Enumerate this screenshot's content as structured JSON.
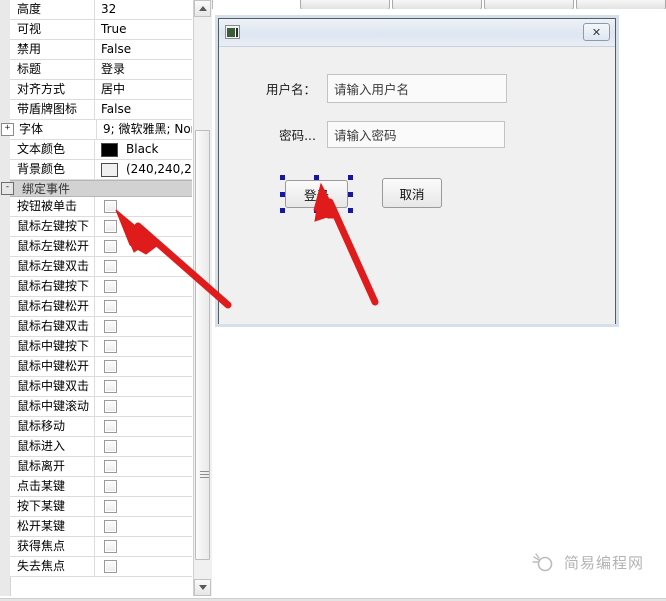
{
  "top_tabs": [
    {
      "label": ""
    },
    {
      "label": ""
    },
    {
      "label": ""
    },
    {
      "label": ""
    }
  ],
  "property_panel": {
    "properties": [
      {
        "name": "高度",
        "value": "32",
        "expander": "",
        "type": "text"
      },
      {
        "name": "可视",
        "value": "True",
        "expander": "",
        "type": "text"
      },
      {
        "name": "禁用",
        "value": "False",
        "expander": "",
        "type": "text"
      },
      {
        "name": "标题",
        "value": "登录",
        "expander": "",
        "type": "text"
      },
      {
        "name": "对齐方式",
        "value": "居中",
        "expander": "",
        "type": "text"
      },
      {
        "name": "带盾牌图标",
        "value": "False",
        "expander": "",
        "type": "text"
      },
      {
        "name": "字体",
        "value": "9; 微软雅黑; Nor",
        "expander": "+",
        "type": "text"
      },
      {
        "name": "文本颜色",
        "value": "Black",
        "expander": "",
        "type": "color",
        "swatch": "#000000"
      },
      {
        "name": "背景颜色",
        "value": "(240,240,2",
        "expander": "",
        "type": "color",
        "swatch": "#f0f0f0"
      }
    ],
    "event_group": {
      "label": "绑定事件",
      "expander": "-"
    },
    "events": [
      {
        "name": "按钮被单击",
        "checked": false
      },
      {
        "name": "鼠标左键按下",
        "checked": false
      },
      {
        "name": "鼠标左键松开",
        "checked": false
      },
      {
        "name": "鼠标左键双击",
        "checked": false
      },
      {
        "name": "鼠标右键按下",
        "checked": false
      },
      {
        "name": "鼠标右键松开",
        "checked": false
      },
      {
        "name": "鼠标右键双击",
        "checked": false
      },
      {
        "name": "鼠标中键按下",
        "checked": false
      },
      {
        "name": "鼠标中键松开",
        "checked": false
      },
      {
        "name": "鼠标中键双击",
        "checked": false
      },
      {
        "name": "鼠标中键滚动",
        "checked": false
      },
      {
        "name": "鼠标移动",
        "checked": false
      },
      {
        "name": "鼠标进入",
        "checked": false
      },
      {
        "name": "鼠标离开",
        "checked": false
      },
      {
        "name": "点击某键",
        "checked": false
      },
      {
        "name": "按下某键",
        "checked": false
      },
      {
        "name": "松开某键",
        "checked": false
      },
      {
        "name": "获得焦点",
        "checked": false
      },
      {
        "name": "失去焦点",
        "checked": false
      }
    ],
    "scrollbar": {
      "up_arrow": "▲",
      "down_arrow": "▼"
    }
  },
  "login_window": {
    "icon_name": "application-icon",
    "close_label": "✕",
    "fields": [
      {
        "label": "用户名：",
        "placeholder": "请输入用户名"
      },
      {
        "label": "密码...",
        "placeholder": "请输入密码"
      }
    ],
    "buttons": [
      {
        "label": "登录",
        "selected": true
      },
      {
        "label": "取消",
        "selected": false
      }
    ],
    "selection_color": "#17179e"
  },
  "annotations": {
    "arrow_color": "#e01b1b",
    "arrows": [
      {
        "name": "arrow-to-click-event-checkbox"
      },
      {
        "name": "arrow-to-login-button"
      }
    ]
  },
  "watermark": {
    "text": "简易编程网",
    "logo_name": "site-logo-icon"
  }
}
